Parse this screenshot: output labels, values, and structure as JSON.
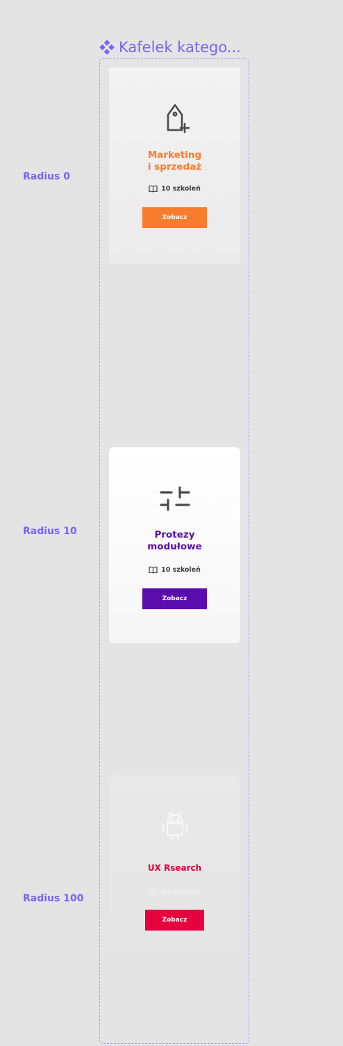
{
  "frame": {
    "title": "Kafelek katego..."
  },
  "rows": [
    {
      "label": "Radius 0"
    },
    {
      "label": "Radius 10"
    },
    {
      "label": "Radius 100"
    }
  ],
  "cards": [
    {
      "icon": "tag-plus-icon",
      "title_line1": "Marketing",
      "title_line2": "i sprzedaż",
      "meta": "10 szkoleń",
      "button": "Zobacz",
      "accent": "#f97b2c"
    },
    {
      "icon": "sliders-icon",
      "title_line1": "Protezy",
      "title_line2": "modułowe",
      "meta": "10 szkoleń",
      "button": "Zobacz",
      "accent": "#5b0cad"
    },
    {
      "icon": "android-icon",
      "title_line1": "UX Rsearch",
      "title_line2": "",
      "meta": "10 szkoleń",
      "button": "Zobacz",
      "accent": "#e6003d"
    }
  ]
}
